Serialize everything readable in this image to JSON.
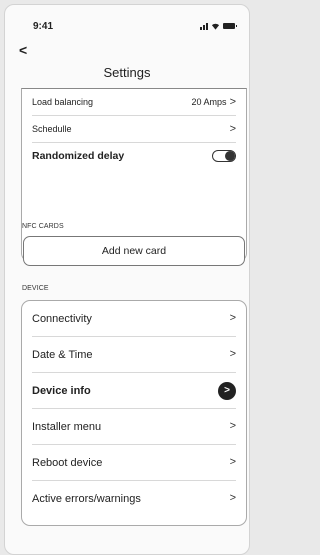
{
  "status_bar": {
    "time": "9:41",
    "icons": [
      "signal-icon",
      "wifi-icon",
      "battery-icon"
    ]
  },
  "header": {
    "back_glyph": "<",
    "title": "Settings"
  },
  "settings_card": {
    "rows": [
      {
        "label": "Load balancing",
        "value": "20 Amps",
        "chevron": ">"
      },
      {
        "label": "Schedulle",
        "value": "",
        "chevron": ">"
      },
      {
        "label": "Randomized delay",
        "toggle": "on"
      }
    ]
  },
  "nfc_section": {
    "heading": "NFC CARDS",
    "add_button_label": "Add new card"
  },
  "device_section": {
    "heading": "DEVICE",
    "rows": [
      {
        "label": "Connectivity",
        "chevron": ">"
      },
      {
        "label": "Date & Time",
        "chevron": ">"
      },
      {
        "label": "Device info",
        "chevron": ">",
        "selected": true
      },
      {
        "label": "Installer menu",
        "chevron": ">"
      },
      {
        "label": "Reboot device",
        "chevron": ">"
      },
      {
        "label": "Active errors/warnings",
        "chevron": ">"
      }
    ]
  },
  "colors": {
    "background": "#e9e9e9",
    "screen": "#fafafa",
    "card_border": "#aaaaaa",
    "accent": "#222222"
  }
}
